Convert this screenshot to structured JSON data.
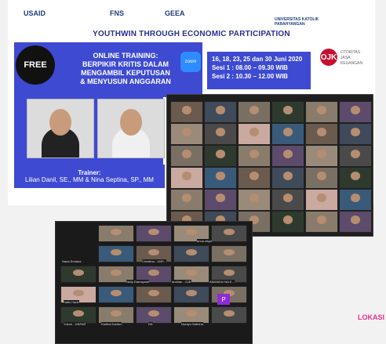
{
  "logos": [
    "USAID",
    "FNS",
    "GEEA",
    "UNIVERSITAS KATOLIK PARAHYANGAN"
  ],
  "headline": "YOUTHWIN THROUGH ECONOMIC PARTICIPATION",
  "banner": {
    "free": "FREE",
    "title_line1": "ONLINE TRAINING:",
    "title_line2": "BERPIKIR KRITIS DALAM",
    "title_line3": "MENGAMBIL KEPUTUSAN",
    "title_line4": "& MENYUSUN ANGGARAN",
    "zoom": "zoom"
  },
  "schedule": {
    "dates": "16, 18, 23, 25 dan 30 Juni 2020",
    "sesi1": "Sesi 1 : 08.00 – 09.30 WIB",
    "sesi2": "Sesi 2 : 10.30 – 12.00 WIB"
  },
  "ojk": {
    "mark": "OJK",
    "text1": "OTORITAS",
    "text2": "JASA",
    "text3": "KEUANGAN"
  },
  "trainer": {
    "label": "Trainer:",
    "names": "Lilian Danil, SE., MM & Nina Septina, SP., MM"
  },
  "zoom2_names": [
    "Nana Enriana",
    "Christina - UNP...",
    "anna.vispe",
    "Nelly Damayanti",
    "andrian - GJE",
    "AMANDA HALE...",
    "Hafiz Harie",
    "P",
    "Yulum - UNPAR",
    "Kartika Danturi",
    "RA",
    "Nurayu Sabrina"
  ],
  "badge": "LOKASI"
}
